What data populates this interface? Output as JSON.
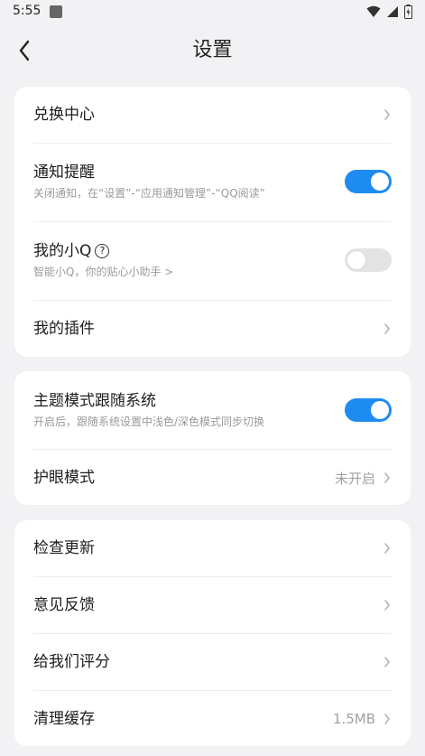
{
  "status_bar": {
    "time": "5:55"
  },
  "header": {
    "title": "设置"
  },
  "section1": {
    "redeem": {
      "label": "兑换中心"
    },
    "notify": {
      "label": "通知提醒",
      "sub": "关闭通知，在“设置”-“应用通知管理”-“QQ阅读”",
      "enabled": true
    },
    "xiaoq": {
      "label": "我的小Q",
      "help": "?",
      "sub": "智能小Q，你的贴心小助手 >",
      "enabled": false
    },
    "plugins": {
      "label": "我的插件"
    }
  },
  "section2": {
    "theme": {
      "label": "主题模式跟随系统",
      "sub": "开启后，跟随系统设置中浅色/深色模式同步切换",
      "enabled": true
    },
    "eye": {
      "label": "护眼模式",
      "value": "未开启"
    }
  },
  "section3": {
    "update": {
      "label": "检查更新"
    },
    "feedback": {
      "label": "意见反馈"
    },
    "rate": {
      "label": "给我们评分"
    },
    "cache": {
      "label": "清理缓存",
      "value": "1.5MB"
    }
  },
  "colors": {
    "accent": "#1e8bf0",
    "background": "#f2f2f4",
    "card": "#ffffff"
  }
}
